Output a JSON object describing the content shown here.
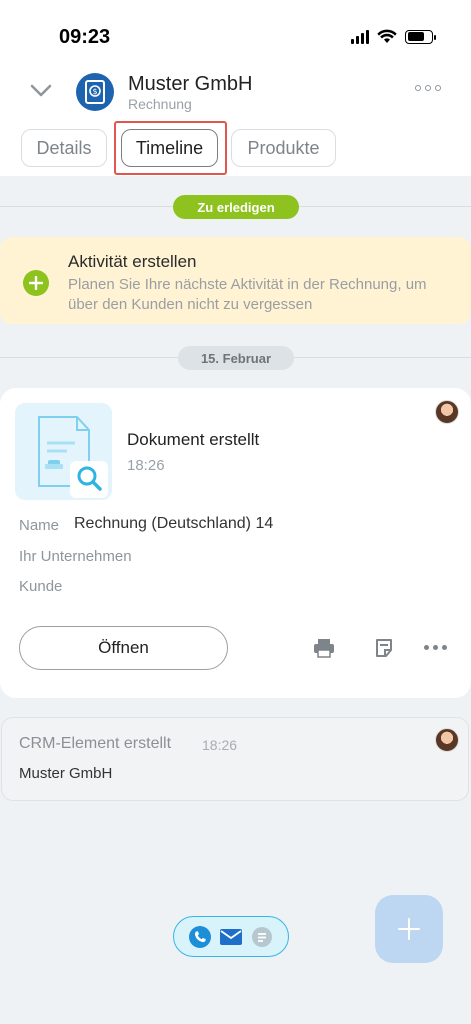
{
  "status_bar": {
    "time": "09:23"
  },
  "header": {
    "title": "Muster GmbH",
    "subtitle": "Rechnung"
  },
  "tabs": [
    {
      "label": "Details",
      "active": false
    },
    {
      "label": "Timeline",
      "active": true
    },
    {
      "label": "Produkte",
      "active": false
    }
  ],
  "timeline": {
    "todo_badge": "Zu erledigen",
    "activity": {
      "title": "Aktivität erstellen",
      "description": "Planen Sie Ihre nächste Aktivität in der Rechnung, um über den Kunden nicht zu vergessen"
    },
    "date_badge": "15. Februar",
    "document_card": {
      "title": "Dokument erstellt",
      "time": "18:26",
      "fields": [
        {
          "label": "Name",
          "value": "Rechnung (Deutschland) 14"
        },
        {
          "label": "Ihr Unternehmen",
          "value": ""
        },
        {
          "label": "Kunde",
          "value": ""
        }
      ],
      "open_button": "Öffnen"
    },
    "crm_card": {
      "title": "CRM-Element erstellt",
      "time": "18:26",
      "value": "Muster GmbH"
    }
  },
  "colors": {
    "accent_green": "#8dc21f",
    "highlight_red": "#e0574f",
    "entity_blue": "#1e63b0",
    "fab_blue": "#bdd7f3",
    "comm_blue": "#35b7e6"
  },
  "icons": {
    "back": "chevron-down-icon",
    "entity": "invoice-icon",
    "more": "more-icon",
    "print": "printer-icon",
    "note": "note-icon",
    "phone": "phone-icon",
    "mail": "mail-icon",
    "chat": "chat-icon",
    "add": "plus-icon"
  }
}
